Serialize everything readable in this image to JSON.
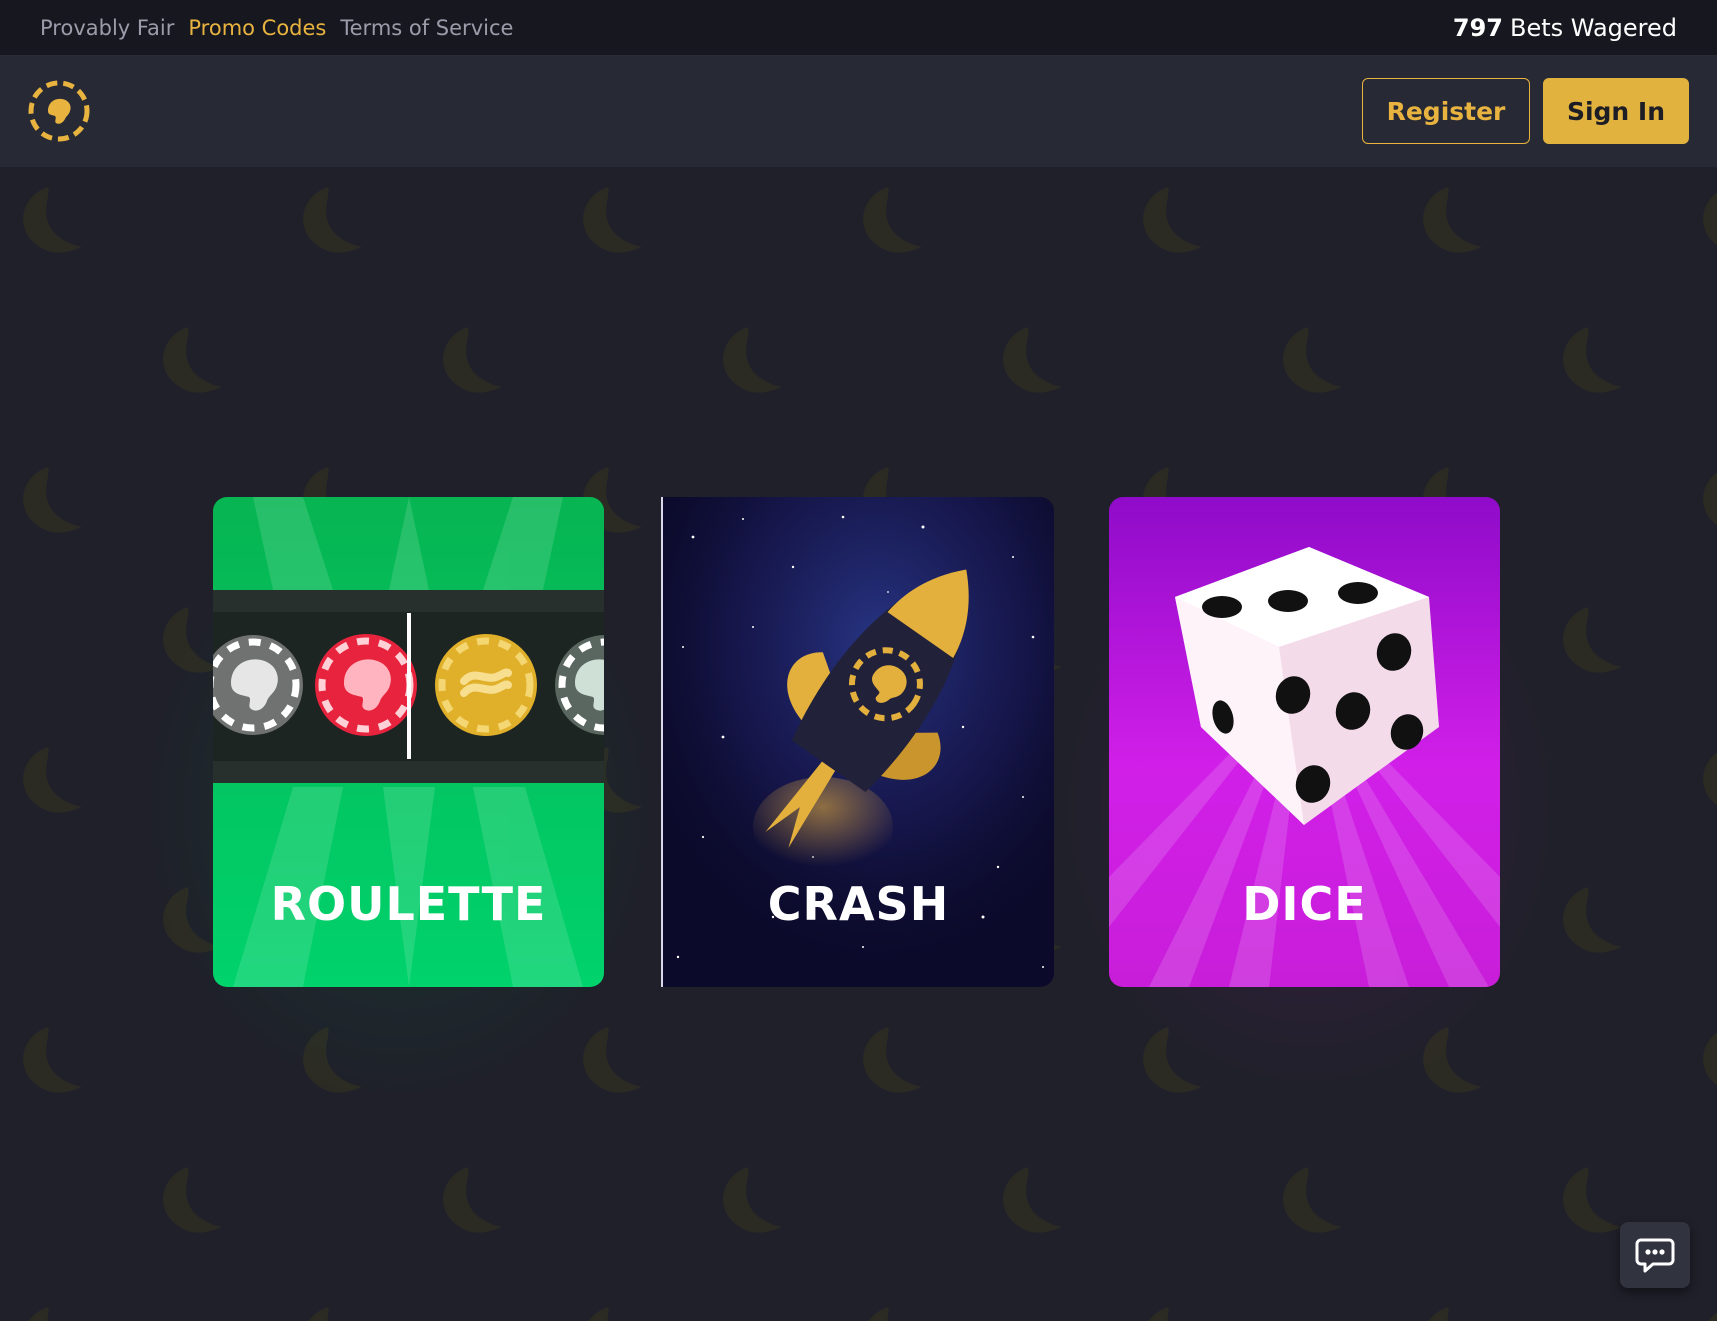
{
  "topbar": {
    "links": [
      {
        "label": "Provably Fair"
      },
      {
        "label": "Promo Codes",
        "active": true
      },
      {
        "label": "Terms of Service"
      }
    ],
    "bets_count": "797",
    "bets_label": "Bets Wagered"
  },
  "header": {
    "logo_icon": "coin-logo-icon",
    "register_label": "Register",
    "signin_label": "Sign In"
  },
  "games": [
    {
      "title": "ROULETTE",
      "color": "#00c862"
    },
    {
      "title": "CRASH",
      "color": "#0b0a2a"
    },
    {
      "title": "DICE",
      "color": "#c81ed9"
    }
  ],
  "chat": {
    "icon": "chat-bubble-icon"
  },
  "colors": {
    "accent": "#e8b33f",
    "background": "#1f2029",
    "header": "#272935",
    "topbar": "#17181f"
  }
}
